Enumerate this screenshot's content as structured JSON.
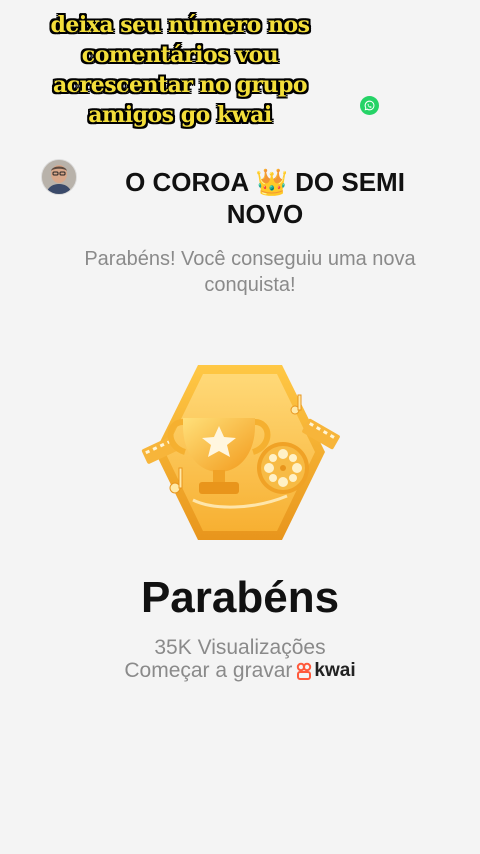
{
  "caption": {
    "lines": [
      "deixa seu número nos",
      "comentários vou",
      "acrescentar no grupo",
      "amigos go kwai"
    ]
  },
  "icons": {
    "whatsapp": "whatsapp-icon",
    "avatar": "avatar",
    "badge": "trophy-badge-icon",
    "kwai": "kwai-logo-icon"
  },
  "header": {
    "title": "O COROA 👑 DO SEMI NOVO"
  },
  "achievement": {
    "message": "Parabéns! Você conseguiu uma nova conquista!",
    "congrats": "Parabéns",
    "views": "35K Visualizações",
    "record": "Começar a gravar",
    "brand": "kwai"
  },
  "colors": {
    "caption_text": "#f3de3a",
    "whatsapp": "#25d366",
    "badge_gold": "#f5b534",
    "kwai_brand": "#ff5a3c"
  }
}
